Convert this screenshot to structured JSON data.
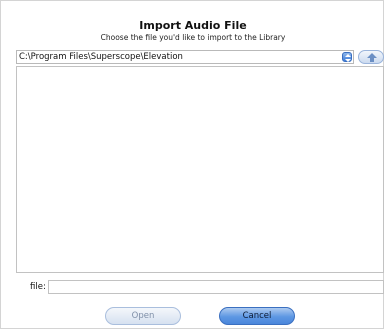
{
  "dialog": {
    "title": "Import Audio File",
    "subtitle": "Choose the file you'd like to import to the Library"
  },
  "path_selector": {
    "value": "C:\\Program Files\\Superscope\\Elevation",
    "arrows_icon": "updown-arrows-icon",
    "up_icon": "up-arrow-icon"
  },
  "file_list": {
    "items": []
  },
  "file_field": {
    "label": "file:",
    "value": "",
    "placeholder": ""
  },
  "buttons": {
    "open_label": "Open",
    "open_enabled": false,
    "cancel_label": "Cancel"
  },
  "colors": {
    "accent": "#4a86db",
    "disabled_text": "#7f8fa8"
  }
}
